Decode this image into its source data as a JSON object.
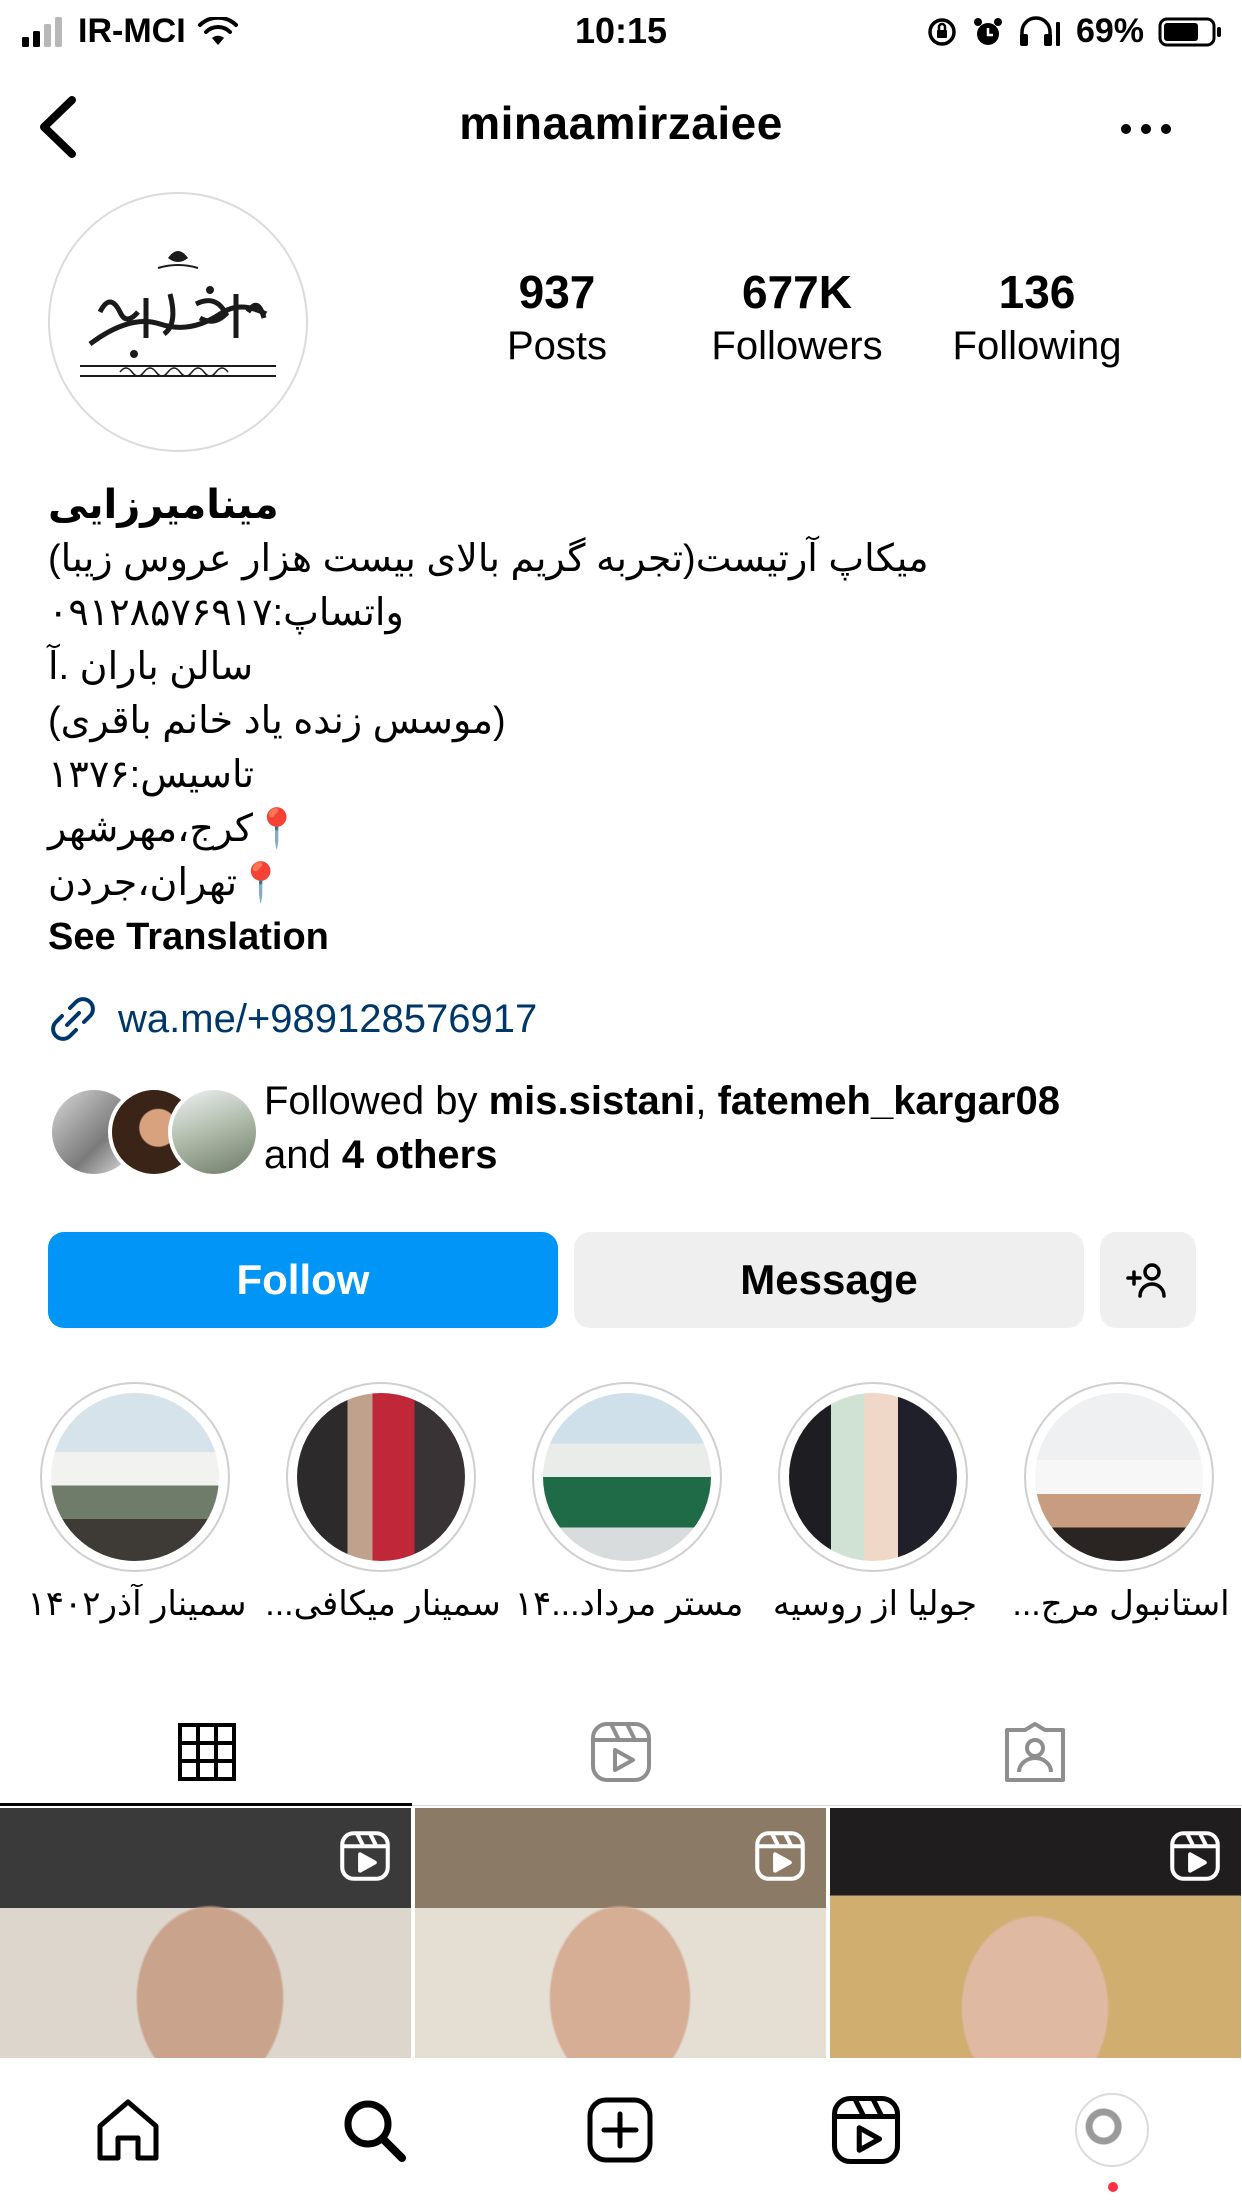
{
  "status_bar": {
    "carrier": "IR-MCI",
    "time": "10:15",
    "battery": "69%"
  },
  "header": {
    "username": "minaamirzaiee"
  },
  "stats": [
    {
      "value": "937",
      "label": "Posts"
    },
    {
      "value": "677K",
      "label": "Followers"
    },
    {
      "value": "136",
      "label": "Following"
    }
  ],
  "bio": {
    "name": "مینامیرزایی",
    "lines": [
      "میکاپ آرتیست(تجربه گریم بالای بیست هزار عروس زیبا)",
      "واتساپ:۰۹۱۲۸۵۷۶۹۱۷",
      "سالن باران .آ",
      "(موسس زنده یاد خانم باقری)",
      "تاسیس:۱۳۷۶",
      "📍کرج،مهرشهر",
      "📍تهران،جردن"
    ],
    "see_translation": "See Translation",
    "link": "wa.me/+989128576917"
  },
  "followed_by": {
    "prefix": "Followed by ",
    "user1": "mis.sistani",
    "sep": ", ",
    "user2": "fatemeh_kargar08",
    "and": "and ",
    "others": "4 others"
  },
  "buttons": {
    "follow": "Follow",
    "message": "Message"
  },
  "highlights": [
    {
      "label": "سمینار آذر۱۴۰۲"
    },
    {
      "label": "سمینار میکافی..."
    },
    {
      "label": "مستر مرداد...۱۴"
    },
    {
      "label": "جولیا از روسیه"
    },
    {
      "label": "استانبول مرج..."
    }
  ],
  "colors": {
    "accent": "#0095f6",
    "link": "#00376b",
    "button_grey": "#efefef",
    "notification_dot": "#ff3040"
  },
  "icons": [
    "back-icon",
    "more-icon",
    "link-icon",
    "add-person-icon",
    "grid-icon",
    "reels-icon",
    "tagged-icon",
    "home-icon",
    "search-icon",
    "create-icon",
    "reels-nav-icon",
    "profile-avatar"
  ]
}
